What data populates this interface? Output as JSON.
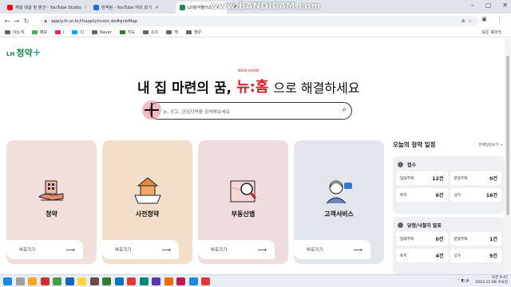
{
  "browser": {
    "tabs": [
      {
        "label": "채널 댓글 및 멘션 - YouTube Studio",
        "active": false,
        "icon": "youtube-icon",
        "color": "#ff0000"
      },
      {
        "label": "번역됨 - YouTube 여의 보기",
        "active": false,
        "icon": "youtube-studio-icon",
        "color": "#1f6feb"
      },
      {
        "label": "LH청약플러스",
        "active": true,
        "icon": "lh-icon",
        "color": "#1c8a4e"
      }
    ],
    "new_tab": "+",
    "url": "apply.lh.or.kr/lhapply/main.do#gnbMap",
    "bookmarks": [
      "아는게",
      "예모",
      "i",
      "디",
      "Naver",
      "지도",
      "쇼츠",
      "책",
      "쟁우"
    ],
    "bookmarks_right": "모든 북마크",
    "watermark": "www.BANDICAM.com"
  },
  "page": {
    "logo_lh": "LH",
    "logo_name": "청약",
    "logo_plus": "+",
    "hero_left": "내 집 마련의 꿈,",
    "hero_brand_small": "NEW:HOME",
    "hero_brand": "뉴:홈",
    "hero_right": "으로 해결하세요",
    "search_placeholder": "뉴, 공고, 관심지역을 검색해보세요",
    "cards": [
      {
        "title": "청약",
        "go": "바로가기",
        "bg": "#f2dfdc",
        "icon": "building-hands-icon"
      },
      {
        "title": "사전청약",
        "go": "바로가기",
        "bg": "#f3dfc9",
        "icon": "house-box-icon"
      },
      {
        "title": "부동산맵",
        "go": "바로가기",
        "bg": "#efdcdf",
        "icon": "map-magnifier-icon"
      },
      {
        "title": "고객서비스",
        "go": "바로가기",
        "bg": "#e2e6ec",
        "icon": "customer-service-icon"
      }
    ]
  },
  "schedule": {
    "title": "오늘의 청약 일정",
    "more": "전체일정보기 +",
    "sections": [
      {
        "name": "접수",
        "rows": [
          [
            {
              "k": "임대주택",
              "v": "12건"
            },
            {
              "k": "분양주택",
              "v": "0건"
            }
          ],
          [
            {
              "k": "토지",
              "v": "6건"
            },
            {
              "k": "상가",
              "v": "16건"
            }
          ]
        ]
      },
      {
        "name": "당첨/낙찰자 발표",
        "rows": [
          [
            {
              "k": "임대주택",
              "v": "0건"
            },
            {
              "k": "분양주택",
              "v": "1건"
            }
          ],
          [
            {
              "k": "토지",
              "v": "4건"
            },
            {
              "k": "상가",
              "v": "9건"
            }
          ]
        ]
      }
    ]
  },
  "taskbar": {
    "time": "오전 9:47",
    "date": "2023-11-08 수요일"
  }
}
